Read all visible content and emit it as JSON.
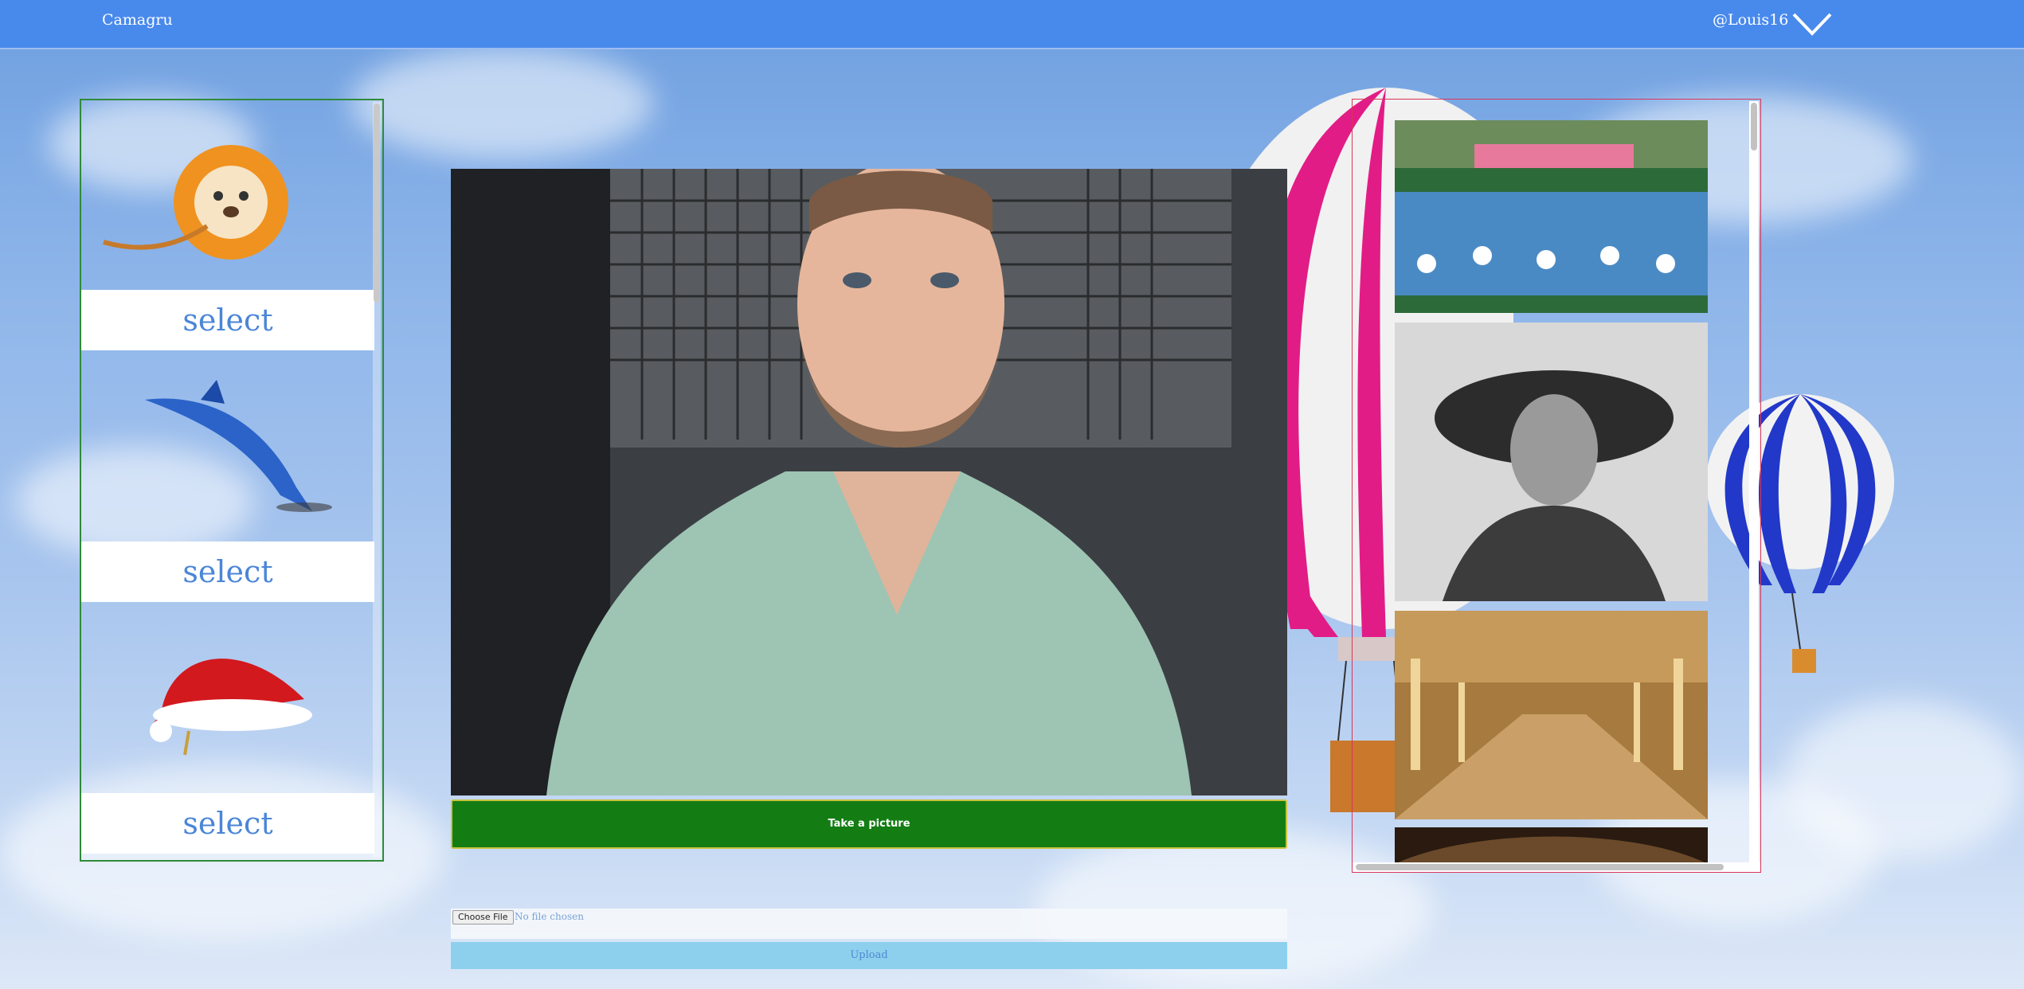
{
  "header": {
    "brand": "Camagru",
    "username": "@Louis16",
    "menu_icon": "chevron-down-icon"
  },
  "stickers": {
    "items": [
      {
        "name": "lion",
        "icon": "lion-sticker",
        "select_label": "select"
      },
      {
        "name": "dolphin",
        "icon": "dolphin-sticker",
        "select_label": "select"
      },
      {
        "name": "santa-hat",
        "icon": "santa-hat-sticker",
        "select_label": "select"
      }
    ]
  },
  "camera": {
    "take_picture_label": "Take a picture"
  },
  "upload": {
    "choose_file_label": "Choose File",
    "file_status": "No file chosen",
    "upload_label": "Upload"
  },
  "gallery": {
    "items": [
      "photo-pandas-group",
      "photo-soldier-portrait",
      "photo-hall-of-mirrors",
      "photo-partial"
    ]
  },
  "colors": {
    "header": "#4889ec",
    "take_button": "#137d14",
    "upload_button": "#8dd0ee",
    "select_text": "#4a86d8"
  }
}
